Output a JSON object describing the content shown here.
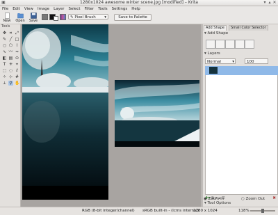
{
  "window": {
    "title": "1280x1024 awesome winter scene.jpg [modified] – Krita"
  },
  "menu": [
    "File",
    "Edit",
    "View",
    "Image",
    "Layer",
    "Select",
    "Filter",
    "Tools",
    "Settings",
    "Help"
  ],
  "toolbar": {
    "new_label": "New",
    "open_label": "Open",
    "save_label": "Save",
    "brush_preset": "Pixel Brush",
    "save_palette_label": "Save to Palette"
  },
  "toolbox": {
    "title": "Tools"
  },
  "dock": {
    "tabs": [
      "Add Shape",
      "Small Color Selector"
    ],
    "add_shape_title": "Add Shape",
    "layers_title": "Layers",
    "blend_mode": "Normal",
    "opacity": "100",
    "tool_options_title": "Tool Options",
    "zoom_in": "Zoom In",
    "zoom_out": "Zoom Out"
  },
  "status": {
    "color_model": "RGB (8-bit integer/channel)",
    "profile": "sRGB built-in - (lcms internal)",
    "size": "1280 x 1024",
    "zoom": "118%"
  },
  "colors": {
    "accent": "#8fb9e8",
    "fg_swatch": "#111111",
    "bg_swatch": "#ffffff"
  }
}
